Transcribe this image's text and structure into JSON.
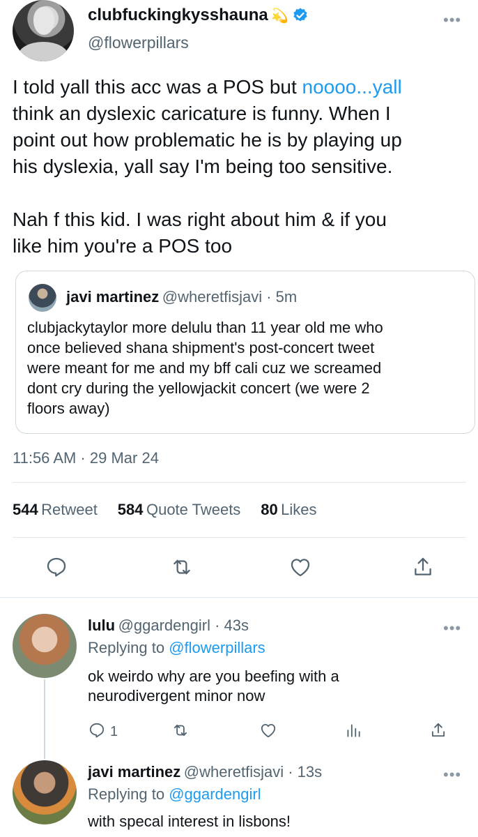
{
  "tweet": {
    "display_name": "clubfuckingkysshauna",
    "name_emoji": "💫",
    "handle": "@flowerpillars",
    "text_lines": [
      "I told yall this acc was a POS but ",
      "think an dyslexic caricature is funny. When I",
      "point out how problematic he is by playing up",
      "his dyslexia, yall say I'm being too sensitive.",
      "Nah f this kid. I was right about him & if you",
      "like him you're a POS too"
    ],
    "link_text": "noooo...yall",
    "more": "•••",
    "timestamp": "11:56 AM · 29 Mar 24"
  },
  "quote": {
    "name": "javi martinez",
    "handle_time": "@wheretfisjavi · 5m",
    "lines": [
      "clubjackytaylor more delulu than 11 year old me who",
      "once believed shana shipment's post-concert tweet",
      "were meant for me and my bff cali cuz we screamed",
      "dont cry during the yellowjackit concert (we were 2",
      "floors away)"
    ]
  },
  "stats": {
    "retweets_num": "544",
    "retweets_label": "Retweet",
    "quotes_num": "584",
    "quotes_label": "Quote Tweets",
    "likes_num": "80",
    "likes_label": "Likes"
  },
  "actions": [
    "reply-icon",
    "retweet-icon",
    "like-icon",
    "share-icon"
  ],
  "replies": [
    {
      "name": "lulu",
      "handle_time": "@ggardengirl · 43s",
      "replying_label": "Replying to ",
      "replying_to": "@flowerpillars",
      "lines": [
        "ok weirdo why are you beefing with a",
        "neurodivergent minor now"
      ],
      "reply_count": "1",
      "more": "•••"
    },
    {
      "name": "javi martinez",
      "handle_time": "@wheretfisjavi · 13s",
      "replying_label": "Replying to ",
      "replying_to": "@ggardengirl",
      "lines": [
        "with specal interest in lisbons!"
      ],
      "more": "•••"
    }
  ],
  "colors": {
    "link": "#1d9bf0",
    "secondary": "#536471",
    "verified": "#1d9bf0"
  }
}
